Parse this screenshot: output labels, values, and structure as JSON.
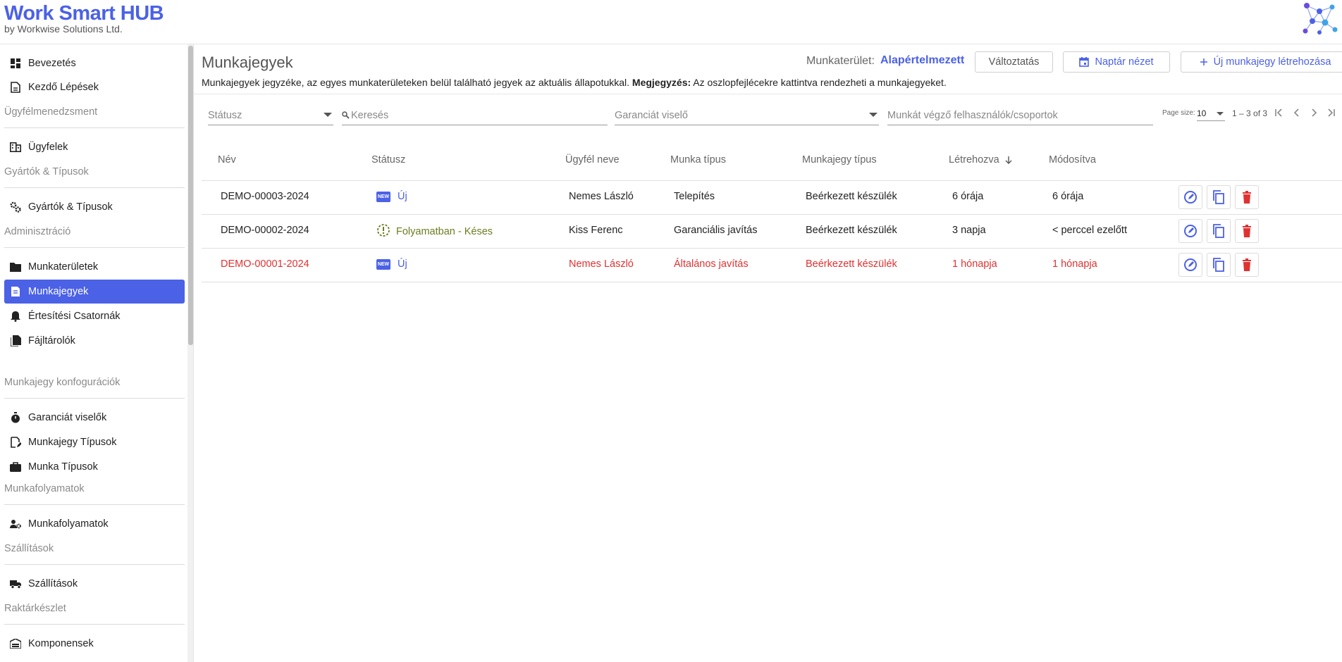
{
  "brand": {
    "title": "Work Smart HUB",
    "subtitle": "by Workwise Solutions Ltd."
  },
  "sidebar": {
    "items": [
      {
        "label": "Bevezetés",
        "icon": "dashboard-icon"
      },
      {
        "label": "Kezdő Lépések",
        "icon": "document-icon"
      },
      {
        "label": "Ügyfelek",
        "icon": "building-icon"
      },
      {
        "label": "Gyártók & Típusok",
        "icon": "gears-icon"
      },
      {
        "label": "Munkaterületek",
        "icon": "folder-icon"
      },
      {
        "label": "Munkajegyek",
        "icon": "ticket-icon",
        "active": true
      },
      {
        "label": "Értesítési Csatornák",
        "icon": "bell-icon"
      },
      {
        "label": "Fájltárolók",
        "icon": "files-icon"
      },
      {
        "label": "Garanciát viselők",
        "icon": "timer-icon"
      },
      {
        "label": "Munkajegy Típusok",
        "icon": "edit-document-icon"
      },
      {
        "label": "Munka Típusok",
        "icon": "briefcase-icon"
      },
      {
        "label": "Munkafolyamatok",
        "icon": "person-gear-icon"
      },
      {
        "label": "Szállítások",
        "icon": "truck-icon"
      },
      {
        "label": "Komponensek",
        "icon": "warehouse-icon"
      }
    ],
    "sections": [
      "Ügyfélmenedzsment",
      "Gyártók & Típusok",
      "Adminisztráció",
      "Munkajegy konfogurációk",
      "Munkafolyamatok",
      "Szállítások",
      "Raktárkészlet"
    ]
  },
  "main": {
    "title": "Munkajegyek",
    "description": "Munkajegyek jegyzéke, az egyes munkaterületeken belül található jegyek az aktuális állapotukkal.",
    "note_label": "Megjegyzés:",
    "note_text": "Az oszlopfejlécekre kattintva rendezheti a munkajegyeket.",
    "workspace_label": "Munkaterület:",
    "workspace_value": "Alapértelmezett",
    "change_button": "Változtatás",
    "calendar_button": "Naptár nézet",
    "new_button": "Új munkajegy létrehozása"
  },
  "filters": {
    "status": "Státusz",
    "search": "Keresés",
    "warranty": "Garanciát viselő",
    "users": "Munkát végző felhasználók/csoportok",
    "page_size_label": "Page size:",
    "page_size": "10",
    "range": "1 – 3 of 3"
  },
  "table": {
    "headers": [
      "Név",
      "Státusz",
      "Ügyfél neve",
      "Munka típus",
      "Munkajegy típus",
      "Létrehozva",
      "Módosítva"
    ],
    "rows": [
      {
        "name": "DEMO-00003-2024",
        "status": "Új",
        "status_kind": "new",
        "customer": "Nemes László",
        "work_type": "Telepítés",
        "ticket_type": "Beérkezett készülék",
        "created": "6 órája",
        "modified": "6 órája",
        "overdue": false
      },
      {
        "name": "DEMO-00002-2024",
        "status": "Folyamatban - Késes",
        "status_kind": "pending",
        "customer": "Kiss Ferenc",
        "work_type": "Garanciális javítás",
        "ticket_type": "Beérkezett készülék",
        "created": "3 napja",
        "modified": "< perccel ezelőtt",
        "overdue": false
      },
      {
        "name": "DEMO-00001-2024",
        "status": "Új",
        "status_kind": "new",
        "customer": "Nemes László",
        "work_type": "Általános javítás",
        "ticket_type": "Beérkezett készülék",
        "created": "1 hónapja",
        "modified": "1 hónapja",
        "overdue": true
      }
    ],
    "new_badge": "NEW"
  },
  "colors": {
    "accent": "#4b61e6",
    "danger": "#e03131",
    "pending": "#6b7d1f"
  }
}
